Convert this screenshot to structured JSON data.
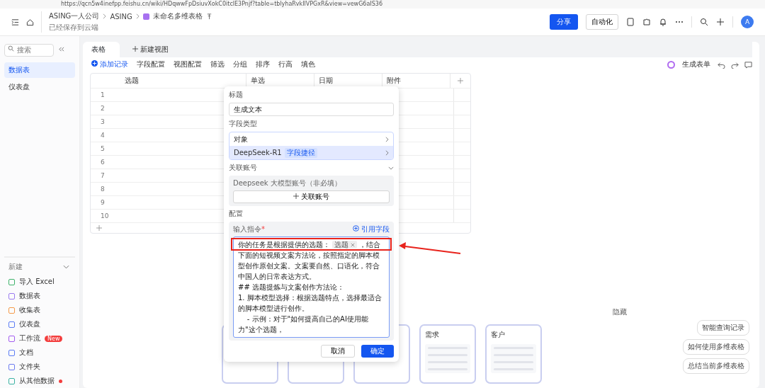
{
  "browser": {
    "url": "https://qcn5w4inefpp.feishu.cn/wiki/HDqwwFpDsiuvXokC0itclE3Pnjf?table=tblyhaRvkIlVPGxR&view=vewG6aIS36"
  },
  "header": {
    "breadcrumbs": [
      "ASING一人公司",
      "ASING",
      "未命名多维表格"
    ],
    "save_status": "已经保存到云端",
    "share_button": "分享",
    "automation_button": "自动化",
    "avatar": "A"
  },
  "sidebar": {
    "search": {
      "placeholder": "搜索"
    },
    "items": [
      {
        "label": "数据表",
        "selected": true
      },
      {
        "label": "仪表盘",
        "selected": false
      }
    ],
    "new_title": "新建",
    "new_items": [
      {
        "label": "导入 Excel",
        "color": "#3fb36b"
      },
      {
        "label": "数据表",
        "color": "#9b7cf0"
      },
      {
        "label": "收集表",
        "color": "#f59a4a"
      },
      {
        "label": "仪表盘",
        "color": "#5b7cf5"
      },
      {
        "label": "工作流",
        "color": "#a35cf0",
        "badge": "New"
      },
      {
        "label": "文档",
        "color": "#5b7cf5"
      },
      {
        "label": "文件夹",
        "color": "#6d7cf0"
      },
      {
        "label": "从其他数据",
        "color": "#3bb3a3",
        "dot": true
      }
    ]
  },
  "views": {
    "tabs": [
      {
        "label": "表格",
        "selected": true
      }
    ],
    "add_view": "新建视图"
  },
  "toolbar": {
    "add_record": "添加记录",
    "tools": [
      "字段配置",
      "视图配置",
      "筛选",
      "分组",
      "排序",
      "行高",
      "填色"
    ],
    "form_button": "生成表单"
  },
  "table": {
    "columns": [
      "选题",
      "单选",
      "日期",
      "附件"
    ],
    "rows": [
      "1",
      "2",
      "3",
      "4",
      "5",
      "6",
      "7",
      "8",
      "9",
      "10"
    ]
  },
  "field_panel": {
    "title_label": "标题",
    "title_value": "生成文本",
    "type_label": "字段类型",
    "types": [
      {
        "label": "对象",
        "selected": false
      },
      {
        "label": "DeepSeek-R1",
        "tag": "字段捷径",
        "selected": true
      }
    ],
    "account_label": "关联账号",
    "account_hint": "Deepseek 大模型账号（非必填）",
    "link_account_button": "关联账号",
    "config_label": "配置",
    "prompt_label": "输入指令",
    "required_mark": "*",
    "reference_button": "引用字段",
    "prompt_before_chip": "你的任务是根据提供的选题：",
    "prompt_chip": "选题",
    "prompt_after_chip": "，结合下面的短视频文案方法论，按照指定的脚本模型创作原创文案。文案要自然、口语化，符合中国人的日常表达方式。",
    "prompt_lines": [
      "## 选题提炼与文案创作方法论：",
      "1. 脚本模型选择：根据选题特点，选择最适合的脚本模型进行创作。",
      "    - 示例：对于\"如何提高自己的AI使用能力\"这个选题，"
    ],
    "cancel_button": "取消",
    "confirm_button": "确定"
  },
  "templates": {
    "hide_label": "隐藏",
    "cards": [
      {
        "title": "需求"
      },
      {
        "title": "客户"
      }
    ]
  },
  "suggestions": [
    "智能查询记录",
    "如何使用多维表格",
    "总结当前多维表格"
  ]
}
